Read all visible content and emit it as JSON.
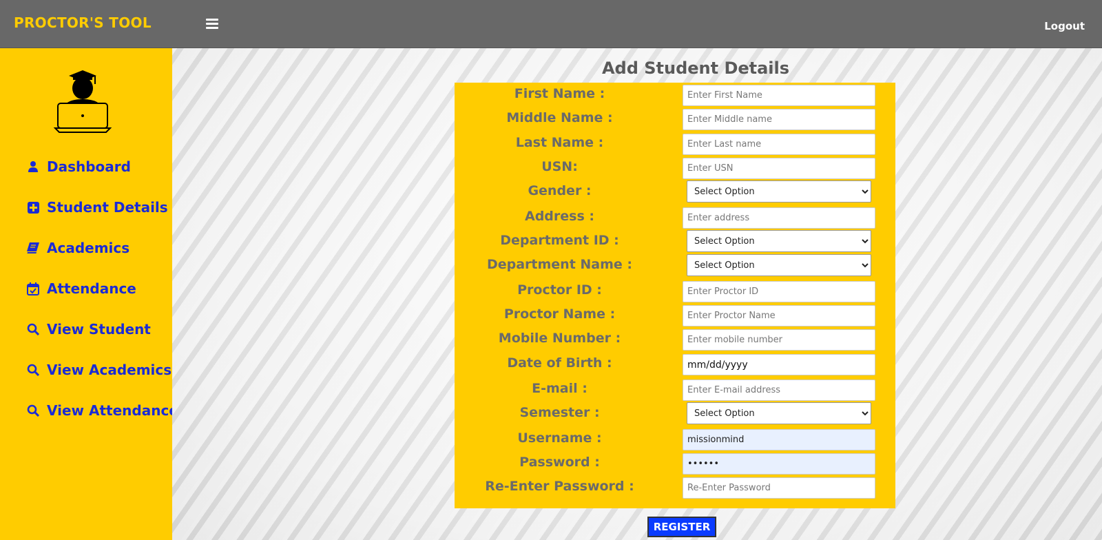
{
  "app": {
    "brand": "PROCTOR'S TOOL",
    "logout_label": "Logout"
  },
  "sidebar": {
    "items": [
      {
        "label": "Dashboard",
        "icon": "user-icon"
      },
      {
        "label": "Student Details",
        "icon": "plus-square-icon"
      },
      {
        "label": "Academics",
        "icon": "book-icon"
      },
      {
        "label": "Attendance",
        "icon": "calendar-check-icon"
      },
      {
        "label": "View Student",
        "icon": "search-icon"
      },
      {
        "label": "View Academics",
        "icon": "search-icon"
      },
      {
        "label": "View Attendance",
        "icon": "search-icon"
      }
    ]
  },
  "form": {
    "title": "Add Student Details",
    "fields": [
      {
        "label": "First Name :",
        "placeholder": "Enter First Name",
        "value": ""
      },
      {
        "label": "Middle Name :",
        "placeholder": "Enter Middle name",
        "value": ""
      },
      {
        "label": "Last Name :",
        "placeholder": "Enter Last name",
        "value": ""
      },
      {
        "label": "USN:",
        "placeholder": "Enter USN",
        "value": ""
      },
      {
        "label": "Gender :",
        "selected": "Select Option"
      },
      {
        "label": "Address :",
        "placeholder": "Enter address",
        "value": ""
      },
      {
        "label": "Department ID :",
        "selected": "Select Option"
      },
      {
        "label": "Department Name :",
        "selected": "Select Option"
      },
      {
        "label": "Proctor ID :",
        "placeholder": "Enter Proctor ID",
        "value": ""
      },
      {
        "label": "Proctor Name :",
        "placeholder": "Enter Proctor Name",
        "value": ""
      },
      {
        "label": "Mobile Number :",
        "placeholder": "Enter mobile number",
        "value": ""
      },
      {
        "label": "Date of Birth :",
        "value": "mm/dd/yyyy"
      },
      {
        "label": "E-mail :",
        "placeholder": "Enter E-mail address",
        "value": ""
      },
      {
        "label": "Semester :",
        "selected": "Select Option"
      },
      {
        "label": "Username :",
        "value": "missionmind"
      },
      {
        "label": "Password :",
        "value": "••••••"
      },
      {
        "label": "Re-Enter Password :",
        "placeholder": "Re-Enter Password",
        "value": ""
      }
    ],
    "register_label": "REGISTER"
  }
}
